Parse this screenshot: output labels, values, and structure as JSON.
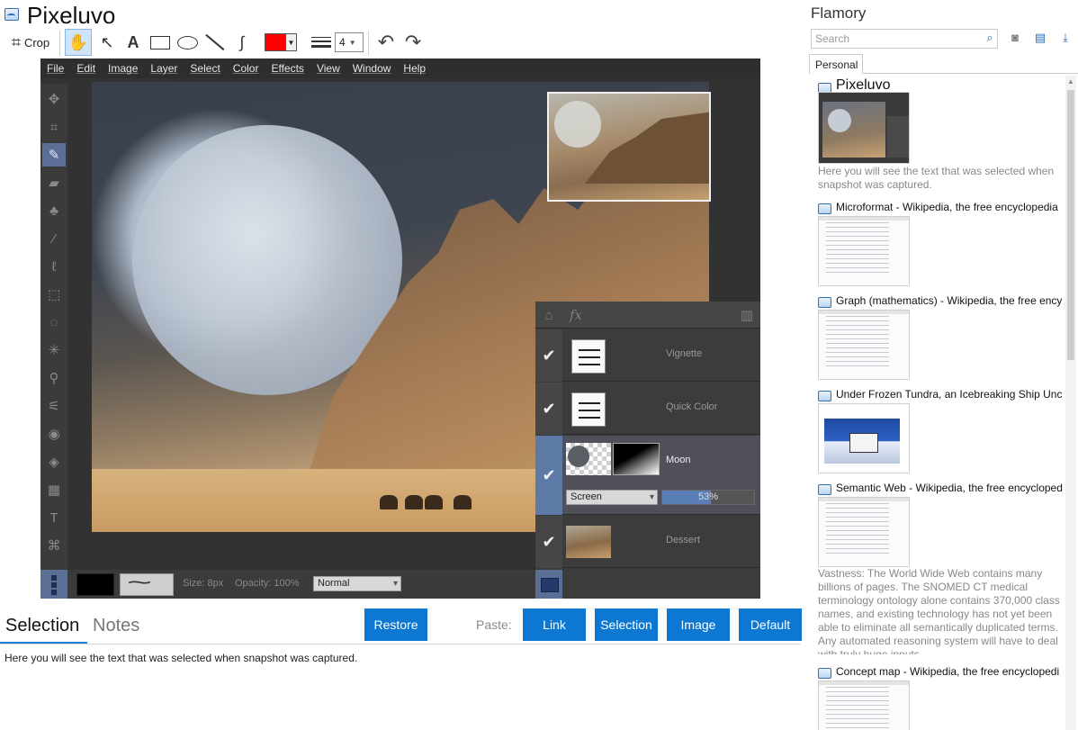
{
  "app": {
    "title": "Pixeluvo",
    "toolbar": {
      "crop_label": "Crop",
      "line_size": "4",
      "selected_color": "#ff0000"
    }
  },
  "screenshot": {
    "menu": [
      "File",
      "Edit",
      "Image",
      "Layer",
      "Select",
      "Color",
      "Effects",
      "View",
      "Window",
      "Help"
    ],
    "layers": [
      {
        "name": "Vignette",
        "checked": true
      },
      {
        "name": "Quick Color",
        "checked": true
      },
      {
        "name": "Moon",
        "checked": true,
        "blend_mode": "Screen",
        "opacity": "53%",
        "opacity_fraction": 0.53
      },
      {
        "name": "Dessert",
        "checked": true
      }
    ],
    "status": {
      "size": "Size: 8px",
      "opacity": "Opacity: 100%",
      "mode": "Normal"
    }
  },
  "bottom": {
    "tabs": [
      "Selection",
      "Notes"
    ],
    "restore": "Restore",
    "paste_label": "Paste:",
    "paste_buttons": [
      "Link",
      "Selection",
      "Image",
      "Default"
    ],
    "selection_text": "Here you will see the text that was selected when snapshot was captured."
  },
  "sidebar": {
    "title": "Flamory",
    "search_placeholder": "Search",
    "tab": "Personal",
    "entries": [
      {
        "title": "Pixeluvo",
        "snippet": "Here you will see the text that was selected when snapshot was captured."
      },
      {
        "title": "Microformat - Wikipedia, the free encyclopedia"
      },
      {
        "title": "Graph (mathematics) - Wikipedia, the free ency"
      },
      {
        "title": "Under Frozen Tundra, an Icebreaking Ship Unco"
      },
      {
        "title": "Semantic Web - Wikipedia, the free encycloped",
        "snippet": "Vastness: The World Wide Web contains many billions of pages. The SNOMED CT medical terminology ontology alone contains 370,000 class names, and existing technology has not yet been able to eliminate all semantically duplicated terms. Any automated reasoning system will have to deal with truly huge inputs."
      },
      {
        "title": "Concept map - Wikipedia, the free encyclopedi"
      }
    ]
  }
}
